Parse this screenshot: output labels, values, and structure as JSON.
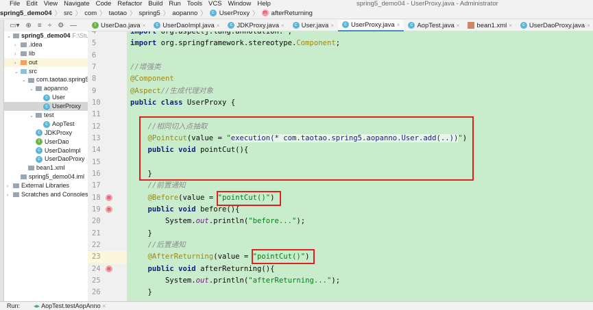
{
  "window_title": "spring5_demo04 - UserProxy.java - Administrator",
  "menu": [
    "File",
    "Edit",
    "View",
    "Navigate",
    "Code",
    "Refactor",
    "Build",
    "Run",
    "Tools",
    "VCS",
    "Window",
    "Help"
  ],
  "breadcrumb": [
    "spring5_demo04",
    "src",
    "com",
    "taotao",
    "spring5",
    "aopanno",
    "UserProxy",
    "afterReturning"
  ],
  "tabs": [
    {
      "label": "UserDao.java",
      "icon": "interface-icon"
    },
    {
      "label": "UserDaoImpl.java",
      "icon": "class-icon"
    },
    {
      "label": "JDKProxy.java",
      "icon": "class-run-icon"
    },
    {
      "label": "User.java",
      "icon": "class-icon"
    },
    {
      "label": "UserProxy.java",
      "icon": "class-icon",
      "active": true
    },
    {
      "label": "AopTest.java",
      "icon": "class-run-icon"
    },
    {
      "label": "bean1.xml",
      "icon": "xml-icon"
    },
    {
      "label": "UserDaoProxy.java",
      "icon": "class-icon"
    }
  ],
  "tree": [
    {
      "label": "spring5_demo04",
      "extra": "F:\\StudyP",
      "depth": 0,
      "fold": "v",
      "type": "module"
    },
    {
      "label": ".idea",
      "depth": 1,
      "fold": ">",
      "type": "folder"
    },
    {
      "label": "lib",
      "depth": 1,
      "fold": ">",
      "type": "folder"
    },
    {
      "label": "out",
      "depth": 1,
      "fold": ">",
      "type": "folder-orange"
    },
    {
      "label": "src",
      "depth": 1,
      "fold": "v",
      "type": "folder-blue"
    },
    {
      "label": "com.taotao.spring5",
      "depth": 2,
      "fold": "v",
      "type": "package"
    },
    {
      "label": "aopanno",
      "depth": 3,
      "fold": "v",
      "type": "package"
    },
    {
      "label": "User",
      "depth": 4,
      "type": "class"
    },
    {
      "label": "UserProxy",
      "depth": 4,
      "type": "class",
      "selected": true
    },
    {
      "label": "test",
      "depth": 3,
      "fold": "v",
      "type": "package"
    },
    {
      "label": "AopTest",
      "depth": 4,
      "type": "class"
    },
    {
      "label": "JDKProxy",
      "depth": 3,
      "type": "class"
    },
    {
      "label": "UserDao",
      "depth": 3,
      "type": "interface"
    },
    {
      "label": "UserDaoImpl",
      "depth": 3,
      "type": "class"
    },
    {
      "label": "UserDaoProxy",
      "depth": 3,
      "type": "class"
    },
    {
      "label": "bean1.xml",
      "depth": 2,
      "type": "xml"
    },
    {
      "label": "spring5_demo04.iml",
      "depth": 1,
      "type": "file"
    },
    {
      "label": "External Libraries",
      "depth": 0,
      "fold": ">",
      "type": "lib"
    },
    {
      "label": "Scratches and Consoles",
      "depth": 0,
      "fold": ">",
      "type": "scratch"
    }
  ],
  "code": [
    {
      "n": "4",
      "tokens": [
        [
          "kw",
          "import"
        ],
        [
          "",
          "org.aspectj.lang.annotation.*;"
        ]
      ]
    },
    {
      "n": "5",
      "tokens": [
        [
          "kw",
          "import"
        ],
        [
          "",
          "org.springframework.stereotype."
        ],
        [
          "cls",
          "Component"
        ],
        [
          "",
          ";"
        ]
      ]
    },
    {
      "n": "6",
      "tokens": []
    },
    {
      "n": "7",
      "tokens": [
        [
          "cmt",
          "//增强类"
        ]
      ]
    },
    {
      "n": "8",
      "tokens": [
        [
          "ann",
          "@Component"
        ]
      ]
    },
    {
      "n": "9",
      "tokens": [
        [
          "ann",
          "@Aspect"
        ],
        [
          "cmt",
          "//生成代理对象"
        ]
      ]
    },
    {
      "n": "10",
      "tokens": [
        [
          "kw",
          "public class"
        ],
        [
          "",
          " UserProxy {"
        ]
      ]
    },
    {
      "n": "11",
      "tokens": []
    },
    {
      "n": "12",
      "tokens": [
        [
          "",
          "    "
        ],
        [
          "cmt",
          "//相同切入点抽取"
        ]
      ]
    },
    {
      "n": "13",
      "tokens": [
        [
          "",
          "    "
        ],
        [
          "ann",
          "@Pointcut"
        ],
        [
          "",
          "(value = "
        ],
        [
          "str",
          "\""
        ],
        [
          "inj",
          "execution(* com.taotao.spring5.aopanno.User.add(..))"
        ],
        [
          "str",
          "\""
        ],
        [
          "",
          ")"
        ]
      ]
    },
    {
      "n": "14",
      "tokens": [
        [
          "",
          "    "
        ],
        [
          "kw",
          "public void"
        ],
        [
          "",
          " pointCut(){"
        ]
      ]
    },
    {
      "n": "15",
      "tokens": []
    },
    {
      "n": "16",
      "tokens": [
        [
          "",
          "    }"
        ]
      ]
    },
    {
      "n": "17",
      "tokens": [
        [
          "",
          "    "
        ],
        [
          "cmt",
          "//前置通知"
        ]
      ]
    },
    {
      "n": "18",
      "tokens": [
        [
          "",
          "    "
        ],
        [
          "ann",
          "@Before"
        ],
        [
          "",
          "(value = "
        ],
        [
          "str",
          "\"pointCut()\""
        ],
        [
          "",
          ")"
        ]
      ],
      "gutter": "m"
    },
    {
      "n": "19",
      "tokens": [
        [
          "",
          "    "
        ],
        [
          "kw",
          "public void"
        ],
        [
          "",
          " before(){"
        ]
      ],
      "gutter": "m"
    },
    {
      "n": "20",
      "tokens": [
        [
          "",
          "        System."
        ],
        [
          "fld",
          "out"
        ],
        [
          "",
          ".println("
        ],
        [
          "str",
          "\"before...\""
        ],
        [
          "",
          ");"
        ]
      ]
    },
    {
      "n": "21",
      "tokens": [
        [
          "",
          "    }"
        ]
      ]
    },
    {
      "n": "22",
      "tokens": [
        [
          "",
          "    "
        ],
        [
          "cmt",
          "//后置通知"
        ]
      ]
    },
    {
      "n": "23",
      "tokens": [
        [
          "",
          "    "
        ],
        [
          "ann",
          "@AfterReturning"
        ],
        [
          "",
          "(value = "
        ],
        [
          "str",
          "\"pointCut()\""
        ],
        [
          "",
          ")"
        ]
      ],
      "current": true
    },
    {
      "n": "24",
      "tokens": [
        [
          "",
          "    "
        ],
        [
          "kw",
          "public void"
        ],
        [
          "",
          " afterReturning(){"
        ]
      ],
      "gutter": "m"
    },
    {
      "n": "25",
      "tokens": [
        [
          "",
          "        System."
        ],
        [
          "fld",
          "out"
        ],
        [
          "",
          ".println("
        ],
        [
          "str",
          "\"afterReturning...\""
        ],
        [
          "",
          ");"
        ]
      ]
    },
    {
      "n": "26",
      "tokens": [
        [
          "",
          "    }"
        ]
      ]
    }
  ],
  "run": {
    "label": "Run:",
    "config": "AopTest.testAopAnno"
  }
}
